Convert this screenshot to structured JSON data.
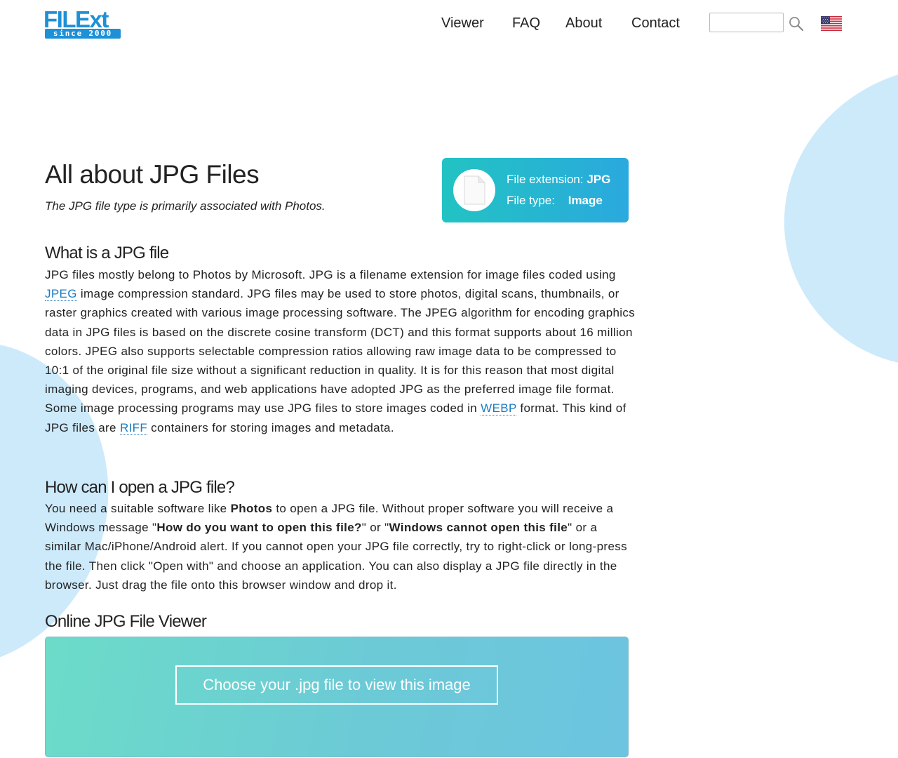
{
  "header": {
    "logo_main": "FILExt",
    "logo_since": "since 2000",
    "nav": [
      "Viewer",
      "FAQ",
      "About",
      "Contact"
    ],
    "search_value": ""
  },
  "main": {
    "title": "All about JPG Files",
    "subtitle": "The JPG file type is primarily associated with Photos.",
    "info_card": {
      "ext_label": "File extension:",
      "ext_value": "JPG",
      "type_label": "File type:",
      "type_value": "Image"
    },
    "what_heading": "What is a JPG file",
    "what_text": {
      "p1": "JPG files mostly belong to Photos by Microsoft. JPG is a filename extension for image files coded using ",
      "link_jpeg": "JPEG",
      "p2": " image compression standard. JPG files may be used to store photos, digital scans, thumbnails, or raster graphics created with various image processing software. The JPEG algorithm for encoding graphics data in JPG files is based on the discrete cosine transform (DCT) and this format supports about 16 million colors. JPEG also supports selectable compression ratios allowing raw image data to be compressed to 10:1 of the original file size without a significant reduction in quality. It is for this reason that most digital imaging devices, programs, and web applications have adopted JPG as the preferred image file format. Some image processing programs may use JPG files to store images coded in ",
      "link_webp": "WEBP",
      "p3": " format. This kind of JPG files are ",
      "link_riff": "RIFF",
      "p4": " containers for storing images and metadata."
    },
    "open_heading": "How can I open a JPG file?",
    "open_text": {
      "p1": "You need a suitable software like ",
      "b1": "Photos",
      "p2": " to open a JPG file. Without proper software you will receive a Windows message \"",
      "b2": "How do you want to open this file?",
      "p3": "\" or \"",
      "b3": "Windows cannot open this file",
      "p4": "\" or a similar Mac/iPhone/Android alert. If you cannot open your JPG file correctly, try to right-click or long-press the file. Then click \"Open with\" and choose an application. You can also display a JPG file directly in the browser. Just drag the file onto this browser window and drop it."
    },
    "viewer_heading": "Online JPG File Viewer",
    "viewer_button": "Choose your .jpg file to view this image"
  },
  "colors": {
    "link": "#1a7bbf",
    "brand": "#1e90d6",
    "card_gradient_start": "#22c3c3",
    "card_gradient_end": "#2aa9de",
    "blob": "#cdeafb"
  }
}
